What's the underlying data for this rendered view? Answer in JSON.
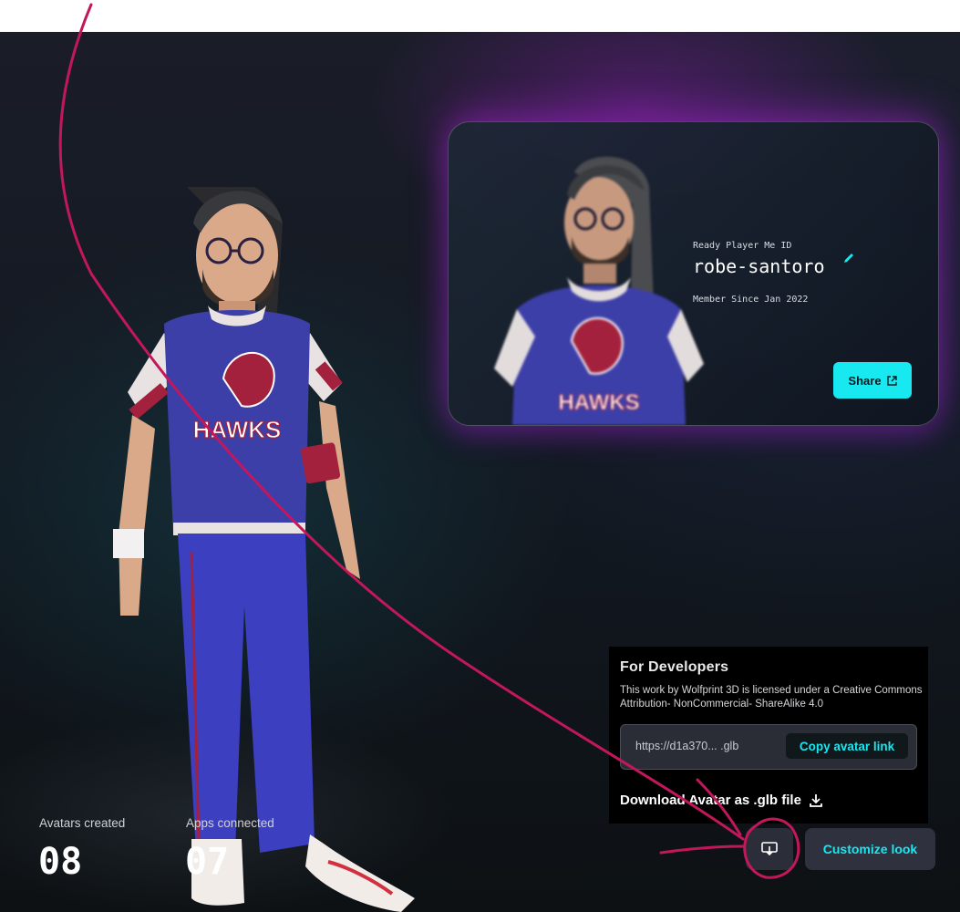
{
  "profile": {
    "id_caption": "Ready Player Me ID",
    "username": "robe-santoro",
    "member_since": "Member Since Jan 2022",
    "share_label": "Share"
  },
  "developers": {
    "title": "For Developers",
    "license": "This work by Wolfprint 3D is licensed under a Creative Commons Attribution- NonCommercial- ShareAlike 4.0",
    "avatar_url": "https://d1a370... .glb",
    "copy_label": "Copy avatar link",
    "download_label": "Download Avatar as .glb file"
  },
  "actions": {
    "customize_label": "Customize look"
  },
  "stats": {
    "avatars_label": "Avatars created",
    "avatars_value": "08",
    "apps_label": "Apps connected",
    "apps_value": "07"
  },
  "avatar": {
    "shirt_text": "HAWKS"
  },
  "colors": {
    "accent": "#18e8f0",
    "annotation": "#c2185b"
  },
  "icons": {
    "share": "external-link-icon",
    "edit": "pencil-icon",
    "download": "download-icon",
    "save": "monitor-download-icon"
  }
}
